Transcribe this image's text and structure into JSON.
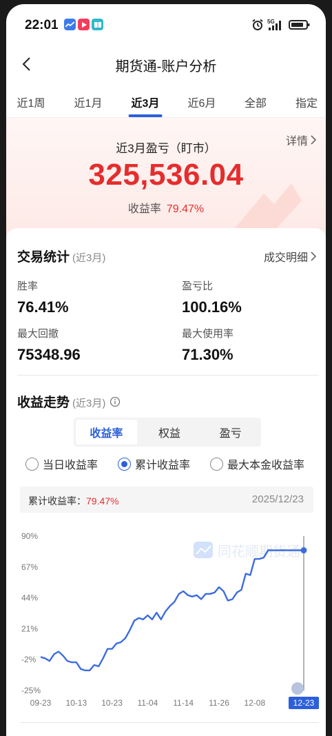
{
  "status_bar": {
    "time": "22:01",
    "app_icons": [
      "stock-chart-app-icon",
      "video-app-icon",
      "book-app-icon"
    ],
    "icons": [
      "alarm-icon",
      "signal-5g-icon",
      "battery-icon"
    ],
    "network": "5G"
  },
  "nav": {
    "back_icon": "chevron-left-icon",
    "title": "期货通-账户分析"
  },
  "tabs": [
    {
      "label": "近1周",
      "active": false
    },
    {
      "label": "近1月",
      "active": false
    },
    {
      "label": "近3月",
      "active": true
    },
    {
      "label": "近6月",
      "active": false
    },
    {
      "label": "全部",
      "active": false
    },
    {
      "label": "指定",
      "active": false
    }
  ],
  "summary": {
    "details_label": "详情",
    "title": "近3月盈亏（盯市）",
    "value": "325,536.04",
    "rate_label": "收益率",
    "rate_value": "79.47%"
  },
  "trade_stats": {
    "title": "交易统计",
    "period": "(近3月)",
    "more_label": "成交明细",
    "items": [
      {
        "label": "胜率",
        "value": "76.41%"
      },
      {
        "label": "盈亏比",
        "value": "100.16%"
      },
      {
        "label": "最大回撤",
        "value": "75348.96"
      },
      {
        "label": "最大使用率",
        "value": "71.30%"
      }
    ]
  },
  "trend": {
    "title": "收益走势",
    "period": "(近3月)",
    "info_icon": "info-circle-icon",
    "segments": [
      {
        "label": "收益率",
        "active": true
      },
      {
        "label": "权益",
        "active": false
      },
      {
        "label": "盈亏",
        "active": false
      }
    ],
    "radios": [
      {
        "label": "当日收益率",
        "checked": false
      },
      {
        "label": "累计收益率",
        "checked": true
      },
      {
        "label": "最大本金收益率",
        "checked": false
      }
    ],
    "cumulative_label": "累计收益率：",
    "cumulative_value": "79.47%",
    "cumulative_date": "2025/12/23",
    "watermark": "同花顺期货通"
  },
  "colors": {
    "accent_blue": "#2c5fdb",
    "profit_red": "#e52d2d",
    "line_blue": "#3d6be0"
  },
  "chart_data": {
    "type": "line",
    "title": "",
    "xlabel": "",
    "ylabel": "",
    "y_ticks": [
      "90%",
      "67%",
      "44%",
      "21%",
      "-2%",
      "-25%"
    ],
    "x_ticks": [
      "09-23",
      "10-13",
      "10-23",
      "11-04",
      "11-14",
      "11-26",
      "12-08",
      "12-23"
    ],
    "ylim": [
      -25,
      90
    ],
    "grid": false,
    "series": [
      {
        "x": [
          "09-23",
          "09-24",
          "09-25",
          "09-26",
          "09-29",
          "09-30",
          "10-09",
          "10-10",
          "10-13",
          "10-14",
          "10-15",
          "10-16",
          "10-17",
          "10-20",
          "10-21",
          "10-22",
          "10-23",
          "10-24",
          "10-27",
          "10-28",
          "10-29",
          "10-30",
          "10-31",
          "11-03",
          "11-04",
          "11-05",
          "11-06",
          "11-07",
          "11-10",
          "11-11",
          "11-12",
          "11-13",
          "11-14",
          "11-17",
          "11-18",
          "11-19",
          "11-20",
          "11-21",
          "11-24",
          "11-25",
          "11-26",
          "11-27",
          "11-28",
          "12-01",
          "12-02",
          "12-03",
          "12-04",
          "12-05",
          "12-08",
          "12-09",
          "12-10",
          "12-11",
          "12-12",
          "12-15",
          "12-16",
          "12-17",
          "12-18",
          "12-19",
          "12-22",
          "12-23"
        ],
        "values": [
          0,
          -1,
          -3,
          2,
          4,
          1,
          -3,
          -4,
          -4,
          -9,
          -10,
          -10,
          -6,
          -7,
          -1,
          6,
          6,
          10,
          11,
          14,
          20,
          27,
          29,
          28,
          31,
          28,
          33,
          28,
          34,
          38,
          41,
          47,
          49,
          46,
          45,
          46,
          43,
          47,
          47,
          48,
          52,
          49,
          42,
          43,
          48,
          50,
          62,
          61,
          73,
          73,
          74,
          79.47,
          79.47,
          79.47,
          79.47,
          79.47,
          79.47,
          79.47,
          79.47,
          79.47
        ]
      }
    ],
    "highlight_x": "12-23",
    "highlight_value": 79.47
  }
}
